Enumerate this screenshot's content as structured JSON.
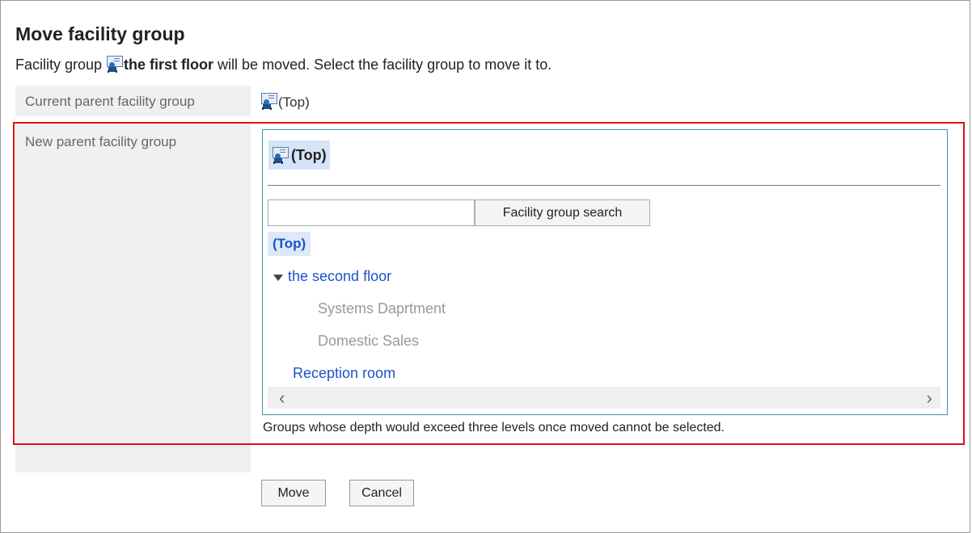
{
  "page": {
    "title": "Move facility group",
    "description_prefix": "Facility group ",
    "facility_group_name": "the first floor",
    "description_suffix": " will be moved. Select the facility group to move it to."
  },
  "current_parent": {
    "label": "Current parent facility group",
    "value": "(Top)"
  },
  "new_parent": {
    "label": "New parent facility group",
    "selected": "(Top)",
    "search_button": "Facility group search",
    "search_value": "",
    "tree": {
      "top": "(Top)",
      "second_floor": "the second floor",
      "systems": "Systems Daprtment",
      "domestic": "Domestic Sales",
      "reception": "Reception room"
    },
    "note": "Groups whose depth would exceed three levels once moved cannot be selected."
  },
  "actions": {
    "move": "Move",
    "cancel": "Cancel"
  },
  "icons": {
    "facility_group": "facility-group-icon",
    "expand": "triangle-down-icon",
    "scroll_left": "chevron-left-icon",
    "scroll_right": "chevron-right-icon"
  },
  "colors": {
    "highlight_border": "#e01010",
    "link": "#1a55c8",
    "selected_bg": "#d6e4f7",
    "label_bg": "#f0f0f0"
  }
}
